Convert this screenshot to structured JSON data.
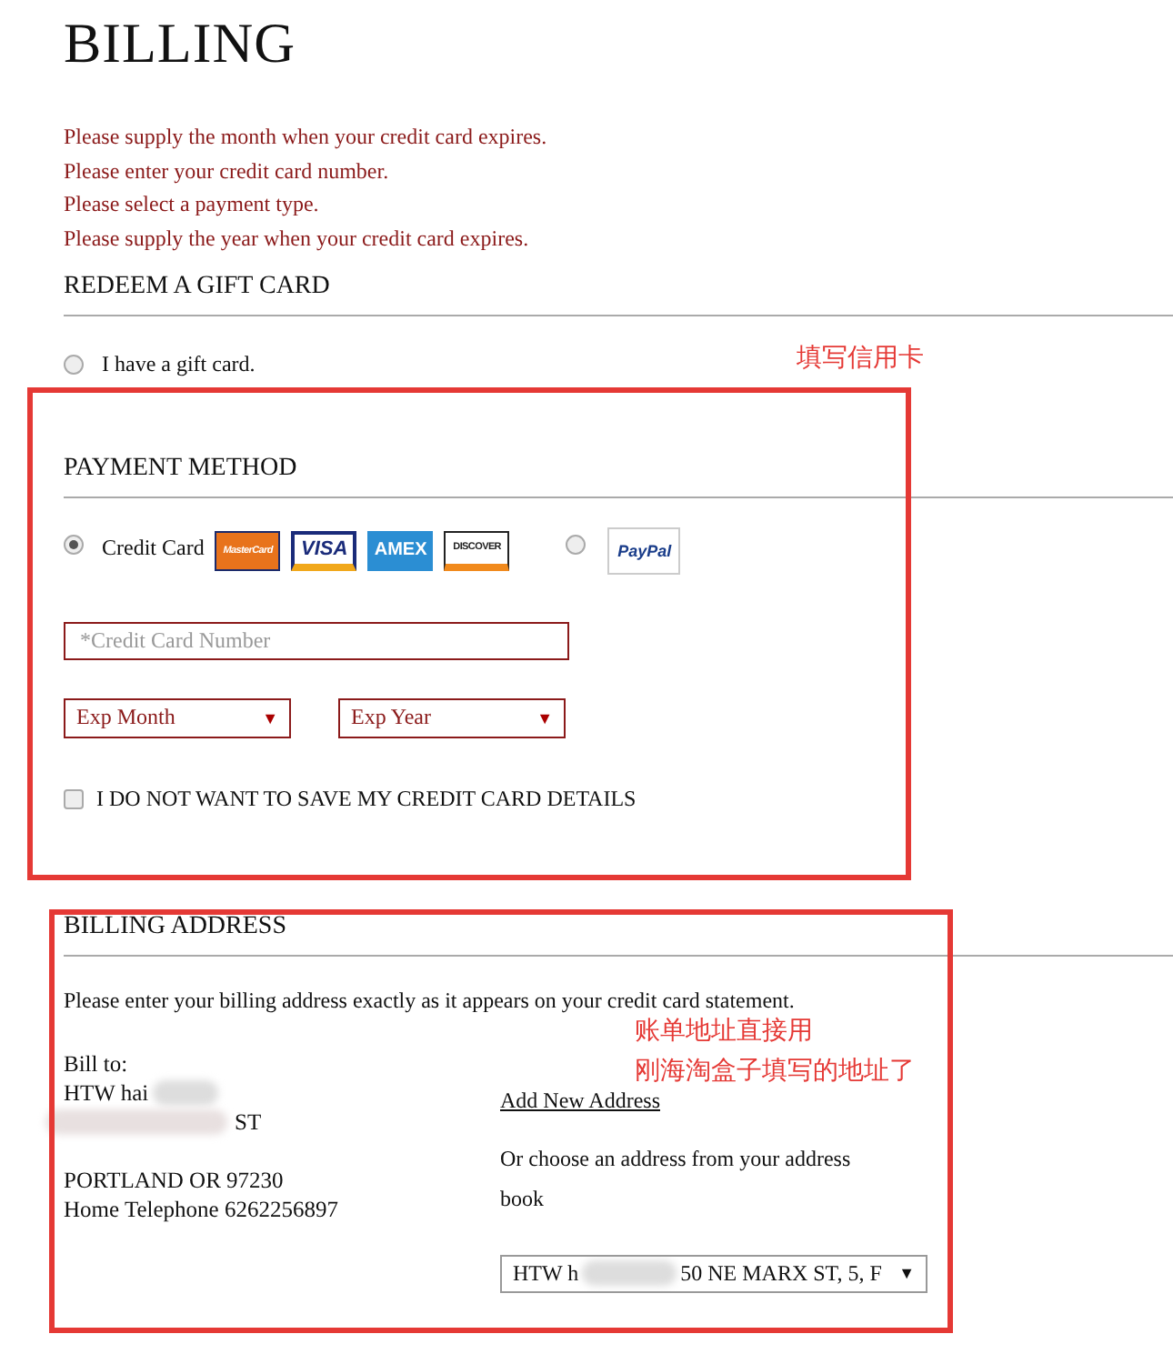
{
  "page_title": "BILLING",
  "errors": [
    "Please supply the month when your credit card expires.",
    "Please enter your credit card number.",
    "Please select a payment type.",
    "Please supply the year when your credit card expires."
  ],
  "gift_card": {
    "heading": "REDEEM A GIFT CARD",
    "option": {
      "label": "I have a gift card.",
      "selected": false
    }
  },
  "payment": {
    "heading": "PAYMENT METHOD",
    "options": [
      {
        "kind": "card",
        "label": "Credit Card",
        "selected": true,
        "logos": [
          {
            "kind": "mastercard",
            "text": "MasterCard"
          },
          {
            "kind": "visa",
            "text": "VISA"
          },
          {
            "kind": "amex",
            "text": "AMEX"
          },
          {
            "kind": "discover",
            "text": "DISCOVER"
          }
        ]
      },
      {
        "kind": "paypal",
        "selected": false,
        "logos": [
          {
            "kind": "paypal",
            "text": "PayPal"
          }
        ]
      }
    ],
    "card_number": {
      "placeholder": "*Credit Card Number"
    },
    "exp_month": {
      "value": "Exp Month",
      "caret": "▼"
    },
    "exp_year": {
      "value": "Exp Year",
      "caret": "▼"
    },
    "no_save": {
      "label": "I DO NOT WANT TO SAVE MY CREDIT CARD DETAILS",
      "checked": false
    }
  },
  "billing": {
    "heading": "BILLING ADDRESS",
    "instructions": "Please enter your billing address exactly as it appears on your credit card statement.",
    "bill_to": [
      {
        "kind": "plain",
        "text": "Bill to:"
      },
      {
        "kind": "blur_after",
        "text": "HTW hai"
      },
      {
        "kind": "blur_before",
        "text": "ST"
      },
      {
        "kind": "hidden"
      },
      {
        "kind": "plain",
        "text": "PORTLAND OR 97230"
      },
      {
        "kind": "plain",
        "text": "Home Telephone 6262256897"
      }
    ],
    "add_link": "Add New Address",
    "choose_text": "Or choose an address from your address book",
    "address_select": {
      "value_start": "HTW h",
      "value_end": "50 NE MARX ST, 5, F",
      "caret": "▼"
    }
  },
  "annotations": [
    {
      "text": "填写信用卡"
    },
    {
      "text": "账单地址直接用"
    },
    {
      "text": "刚海淘盒子填写的地址了"
    }
  ]
}
